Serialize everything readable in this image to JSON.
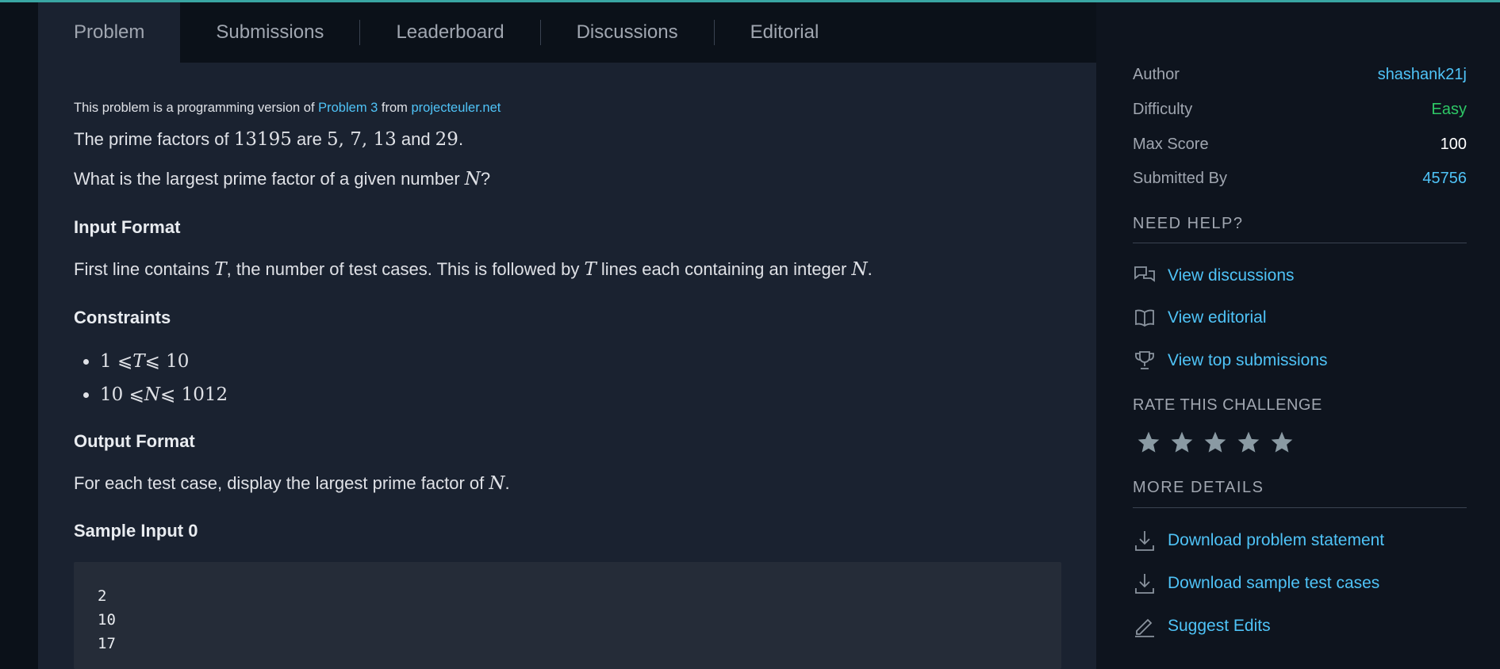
{
  "tabs": [
    {
      "label": "Problem"
    },
    {
      "label": "Submissions"
    },
    {
      "label": "Leaderboard"
    },
    {
      "label": "Discussions"
    },
    {
      "label": "Editorial"
    }
  ],
  "problem": {
    "source_prefix": "This problem is a programming version of ",
    "source_link": "Problem 3",
    "source_mid": " from ",
    "source_site": "projecteuler.net",
    "p1_a": "The prime factors of ",
    "p1_num": "13195",
    "p1_b": " are ",
    "p1_factors": "5, 7, 13",
    "p1_c": " and ",
    "p1_last": "29",
    "p1_d": ".",
    "p2_a": "What is the largest prime factor of a given number ",
    "p2_var": "N",
    "p2_b": "?",
    "input_heading": "Input Format",
    "input_a": "First line contains ",
    "input_t1": "T",
    "input_b": ", the number of test cases. This is followed by ",
    "input_t2": "T",
    "input_c": " lines each containing an integer ",
    "input_n": "N",
    "input_d": ".",
    "constraints_heading": "Constraints",
    "c1_lo": "1 ⩽ ",
    "c1_var": "T",
    "c1_hi": " ⩽ 10",
    "c2_lo": "10 ⩽ ",
    "c2_var": "N",
    "c2_hi": " ⩽ 10",
    "c2_exp": "12",
    "output_heading": "Output Format",
    "output_a": "For each test case, display the largest prime factor of ",
    "output_n": "N",
    "output_b": ".",
    "sample_heading": "Sample Input 0",
    "sample_lines": [
      "2",
      "10",
      "17"
    ]
  },
  "sidebar": {
    "author_key": "Author",
    "author_val": "shashank21j",
    "difficulty_key": "Difficulty",
    "difficulty_val": "Easy",
    "maxscore_key": "Max Score",
    "maxscore_val": "100",
    "submitted_key": "Submitted By",
    "submitted_val": "45756",
    "need_help": "NEED HELP?",
    "view_discussions": "View discussions",
    "view_editorial": "View editorial",
    "view_top": "View top submissions",
    "rate": "RATE THIS CHALLENGE",
    "rating": 0,
    "more_details": "MORE DETAILS",
    "download_statement": "Download problem statement",
    "download_samples": "Download sample test cases",
    "suggest_edits": "Suggest Edits"
  },
  "colors": {
    "accent": "#4fc3f7",
    "easy": "#2ec866",
    "star": "#8a9aa3"
  }
}
